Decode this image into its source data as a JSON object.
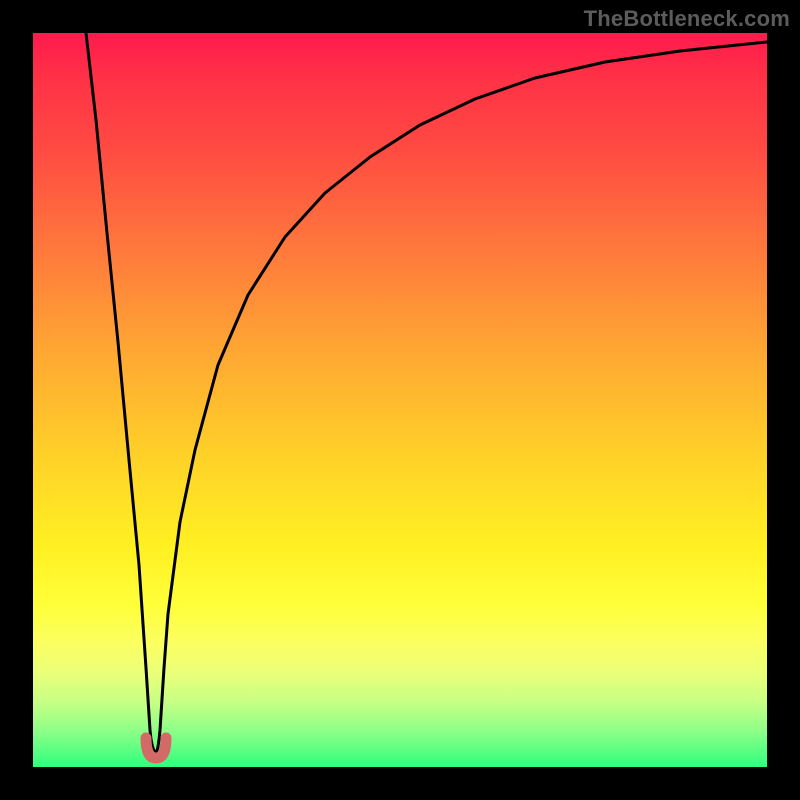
{
  "watermark": "TheBottleneck.com",
  "colors": {
    "frame": "#000000",
    "curve_stroke": "#000000",
    "marker_fill": "#d26a68",
    "marker_stroke": "#c85f5c"
  },
  "chart_data": {
    "type": "line",
    "title": "",
    "xlabel": "",
    "ylabel": "",
    "xlim": [
      0,
      100
    ],
    "ylim": [
      0,
      100
    ],
    "grid": false,
    "legend": false,
    "note": "No axis ticks or labels are rendered; values are estimated from pixel geometry normalized to 0–100 on each axis.",
    "minimum": {
      "x": 16,
      "y": 2
    },
    "series": [
      {
        "name": "left-branch",
        "x": [
          7.2,
          8.5,
          10,
          11.5,
          13,
          14.3,
          15.3,
          16
        ],
        "y": [
          100,
          88,
          73,
          58,
          42,
          27,
          13,
          2
        ]
      },
      {
        "name": "right-branch",
        "x": [
          17.3,
          18.5,
          20,
          23,
          27,
          32,
          38,
          45,
          53,
          62,
          72,
          83,
          95,
          100
        ],
        "y": [
          2,
          13,
          25,
          40,
          52.5,
          62.5,
          70.5,
          77,
          82,
          85.8,
          88.7,
          90.8,
          92.3,
          92.8
        ]
      }
    ],
    "markers": [
      {
        "x": 15.4,
        "y": 3.0
      },
      {
        "x": 17.3,
        "y": 3.0
      }
    ]
  }
}
